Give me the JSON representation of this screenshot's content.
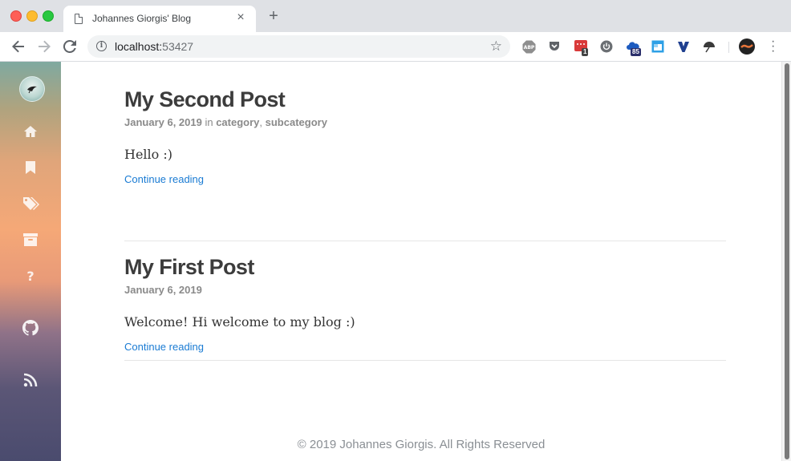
{
  "browser": {
    "tab_title": "Johannes Giorgis' Blog",
    "url_host": "localhost:",
    "url_port": "53427",
    "extensions": [
      {
        "name": "adblock-plus-icon",
        "label": "ABP"
      },
      {
        "name": "pocket-icon"
      },
      {
        "name": "todoist-icon",
        "badge": "1"
      },
      {
        "name": "power-icon"
      },
      {
        "name": "cloud-icon",
        "badge": "85"
      },
      {
        "name": "window-icon"
      },
      {
        "name": "vimium-icon"
      },
      {
        "name": "umbrella-icon"
      }
    ]
  },
  "sidebar": {
    "icons": [
      "home-icon",
      "bookmark-icon",
      "tags-icon",
      "archive-icon",
      "help-icon",
      "github-icon",
      "rss-icon"
    ]
  },
  "posts": [
    {
      "title": "My Second Post",
      "date": "January 6, 2019",
      "in": " in ",
      "categories": [
        "category",
        "subcategory"
      ],
      "excerpt": "Hello :)",
      "read_more": "Continue reading"
    },
    {
      "title": "My First Post",
      "date": "January 6, 2019",
      "excerpt": "Welcome! Hi welcome to my blog :)",
      "read_more": "Continue reading"
    }
  ],
  "footer": {
    "text": "© 2019 Johannes Giorgis. All Rights Reserved"
  },
  "colors": {
    "link": "#1a7bd3",
    "title": "#3c3c3c",
    "meta": "#8a8a8a"
  }
}
